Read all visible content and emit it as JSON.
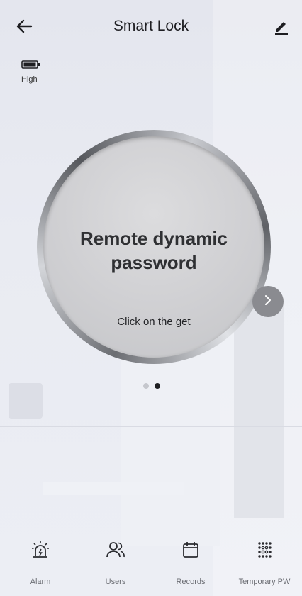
{
  "header": {
    "title": "Smart Lock",
    "back_icon": "arrow-left-icon",
    "edit_icon": "pencil-icon"
  },
  "battery": {
    "label": "High",
    "icon": "battery-icon"
  },
  "dial": {
    "title": "Remote dynamic password",
    "hint": "Click on the get"
  },
  "carousel": {
    "next_icon": "chevron-right-icon",
    "pages": 2,
    "active_page": 2
  },
  "tabs": [
    {
      "label": "Alarm",
      "icon": "alarm-icon"
    },
    {
      "label": "Users",
      "icon": "users-icon"
    },
    {
      "label": "Records",
      "icon": "calendar-icon"
    },
    {
      "label": "Temporary PW",
      "icon": "keypad-icon"
    }
  ]
}
